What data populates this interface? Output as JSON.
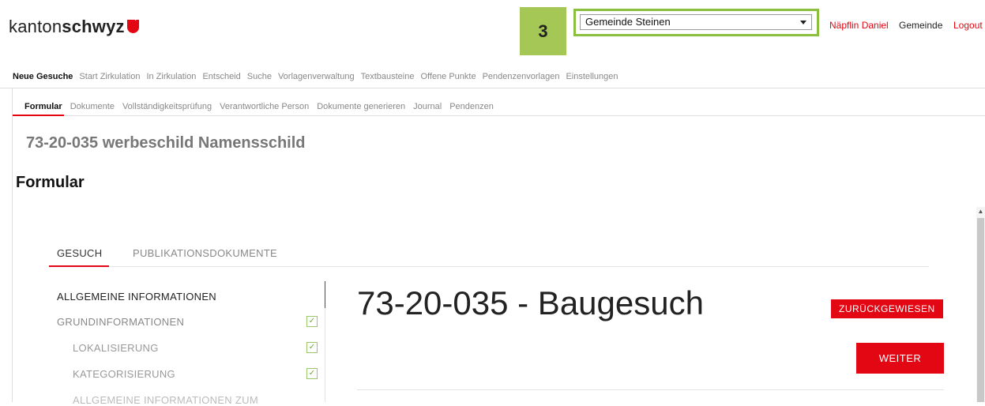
{
  "header": {
    "logo_light": "kanton",
    "logo_bold": "schwyz",
    "step_badge": "3",
    "gemeinde_select": "Gemeinde Steinen",
    "user_name": "Näpflin Daniel",
    "role": "Gemeinde",
    "logout": "Logout"
  },
  "main_nav": [
    "Neue Gesuche",
    "Start Zirkulation",
    "In Zirkulation",
    "Entscheid",
    "Suche",
    "Vorlagenverwaltung",
    "Textbausteine",
    "Offene Punkte",
    "Pendenzenvorlagen",
    "Einstellungen"
  ],
  "sub_nav": [
    "Formular",
    "Dokumente",
    "Vollständigkeitsprüfung",
    "Verantwortliche Person",
    "Dokumente generieren",
    "Journal",
    "Pendenzen"
  ],
  "page_title": "73-20-035 werbeschild Namensschild",
  "section_title": "Formular",
  "tabs": [
    "GESUCH",
    "PUBLIKATIONSDOKUMENTE"
  ],
  "side_menu": [
    {
      "label": "ALLGEMEINE INFORMATIONEN",
      "check": ""
    },
    {
      "label": "GRUNDINFORMATIONEN",
      "check": "✓"
    },
    {
      "label": "LOKALISIERUNG",
      "check": "✓"
    },
    {
      "label": "KATEGORISIERUNG",
      "check": "✓"
    },
    {
      "label": "ALLGEMEINE INFORMATIONEN ZUM",
      "check": ""
    }
  ],
  "content": {
    "title": "73-20-035 - Baugesuch",
    "status": "ZURÜCKGEWIESEN",
    "next_button": "WEITER"
  },
  "colors": {
    "accent": "#e30613",
    "badge_green": "#a5c755",
    "frame_green": "#8bbf3e"
  }
}
